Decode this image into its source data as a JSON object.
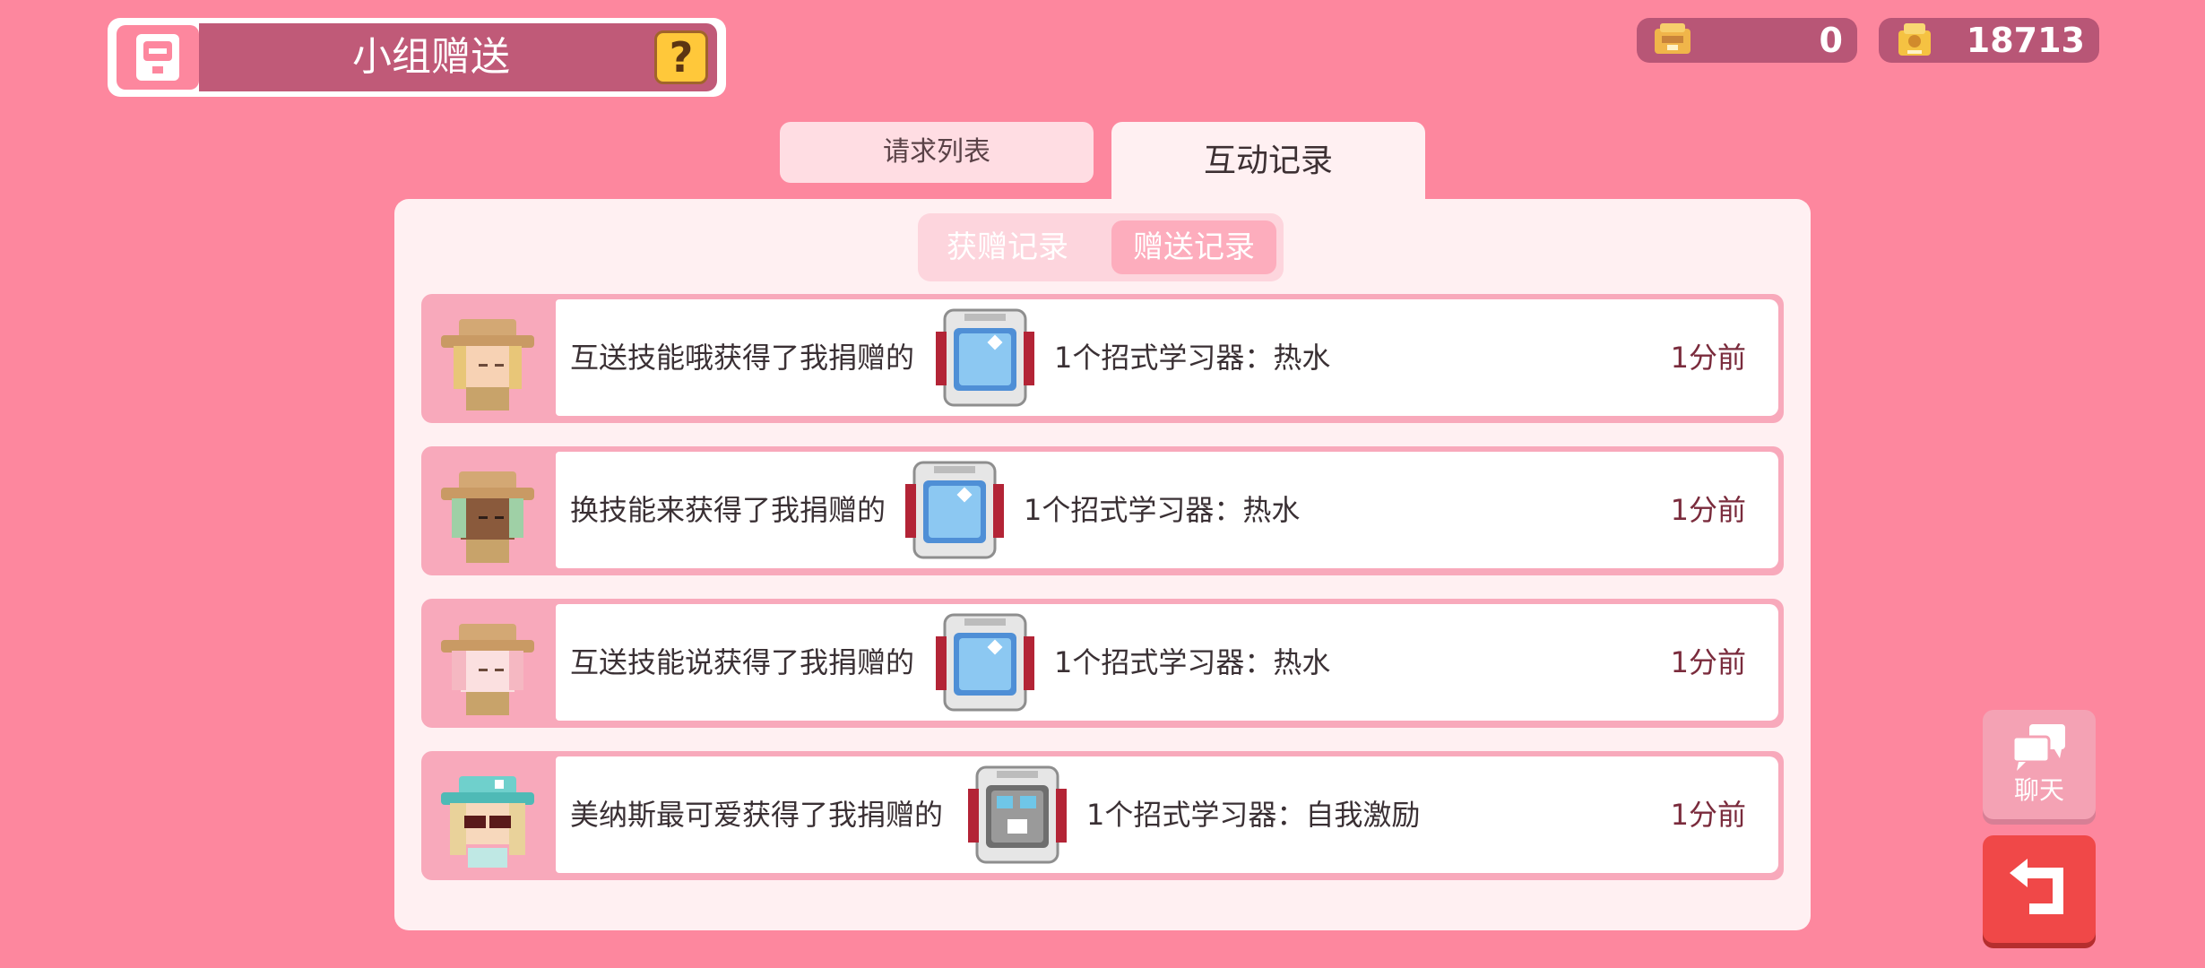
{
  "header": {
    "title": "小组赠送",
    "help_label": "?"
  },
  "currency": {
    "bean_count": "0",
    "coin_count": "18713"
  },
  "tabs": {
    "request_list": "请求列表",
    "interaction_records": "互动记录"
  },
  "segment": {
    "received": "获赠记录",
    "sent": "赠送记录"
  },
  "records": [
    {
      "message": "互送技能哦获得了我捐赠的",
      "item": "1个招式学习器：热水",
      "time": "1分前"
    },
    {
      "message": "换技能来获得了我捐赠的",
      "item": "1个招式学习器：热水",
      "time": "1分前"
    },
    {
      "message": "互送技能说获得了我捐赠的",
      "item": "1个招式学习器：热水",
      "time": "1分前"
    },
    {
      "message": "美纳斯最可爱获得了我捐赠的",
      "item": "1个招式学习器：自我激励",
      "time": "1分前"
    }
  ],
  "side": {
    "chat_label": "聊天"
  }
}
